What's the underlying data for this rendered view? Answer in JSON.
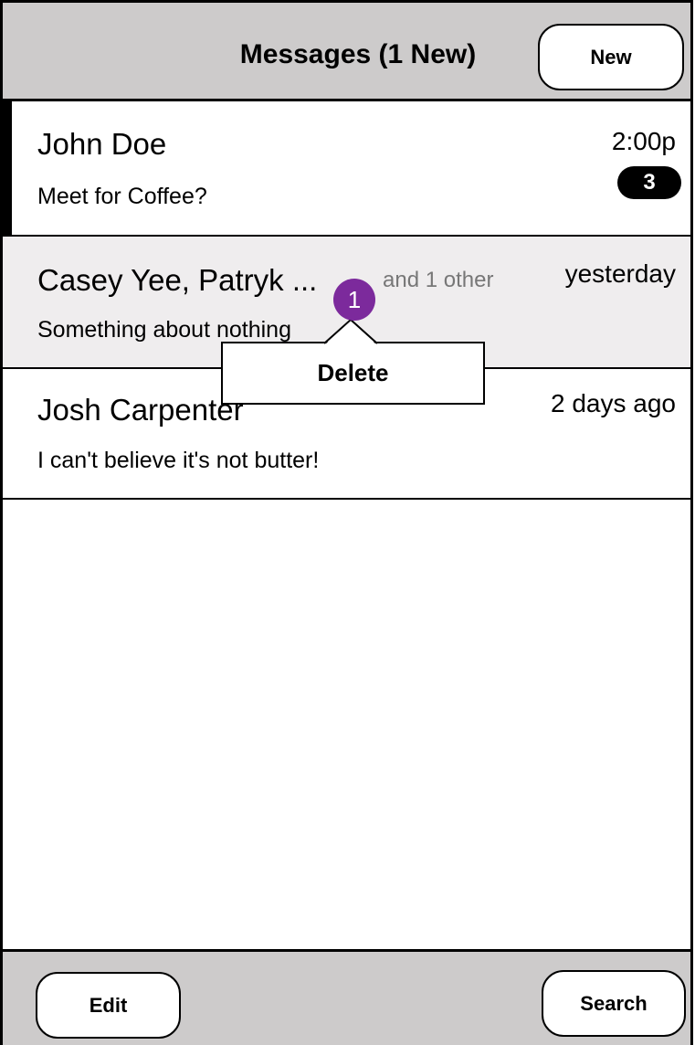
{
  "header": {
    "title": "Messages (1 New)",
    "new_button": "New"
  },
  "messages": [
    {
      "name": "John Doe",
      "preview": "Meet for Coffee?",
      "time": "2:00p",
      "unread_count": "3"
    },
    {
      "name": "Casey Yee, Patryk ...",
      "others": "and 1 other",
      "preview": "Something about nothing",
      "time": "yesterday"
    },
    {
      "name": "Josh Carpenter",
      "preview": "I can't believe it's not butter!",
      "time": "2 days ago"
    }
  ],
  "context_menu": {
    "marker": "1",
    "delete_label": "Delete"
  },
  "footer": {
    "edit_button": "Edit",
    "search_button": "Search"
  },
  "colors": {
    "bar_bg": "#cdcbcb",
    "selected_row_bg": "#efedee",
    "marker": "#7c2a9c"
  }
}
